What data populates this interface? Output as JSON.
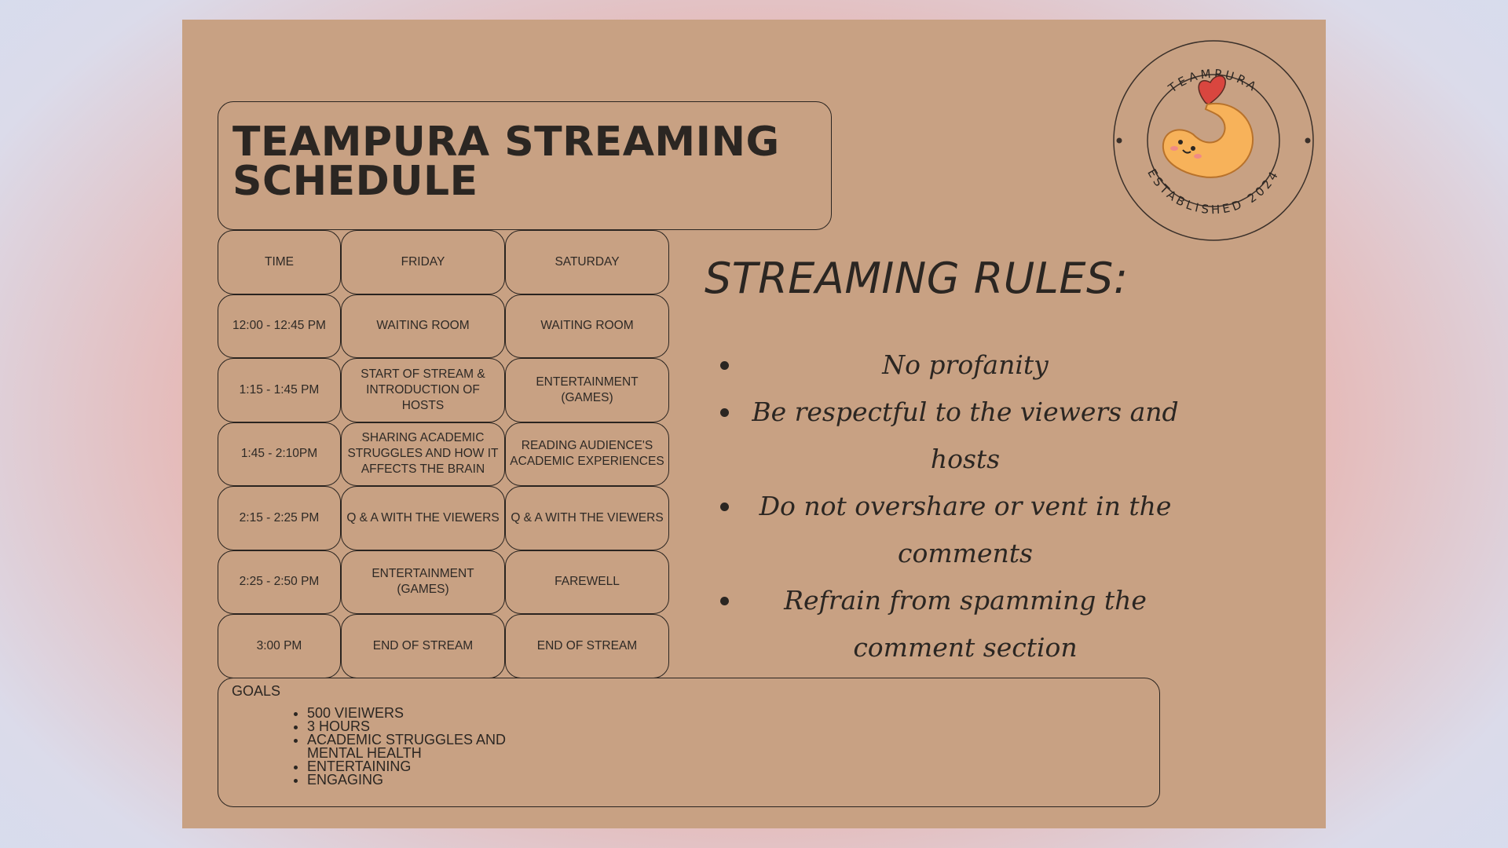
{
  "title": "TEAMPURA STREAMING\nSCHEDULE",
  "schedule": {
    "headers": [
      "TIME",
      "FRIDAY",
      "SATURDAY"
    ],
    "rows": [
      [
        "12:00 - 12:45 PM",
        "WAITING ROOM",
        "WAITING ROOM"
      ],
      [
        "1:15 - 1:45 PM",
        "START OF STREAM & INTRODUCTION OF HOSTS",
        "ENTERTAINMENT (GAMES)"
      ],
      [
        "1:45 - 2:10PM",
        "SHARING ACADEMIC STRUGGLES AND HOW IT AFFECTS THE BRAIN",
        "READING AUDIENCE'S ACADEMIC EXPERIENCES"
      ],
      [
        "2:15 - 2:25 PM",
        "Q & A WITH THE VIEWERS",
        "Q & A WITH THE VIEWERS"
      ],
      [
        "2:25 - 2:50 PM",
        "ENTERTAINMENT (GAMES)",
        "FAREWELL"
      ],
      [
        "3:00 PM",
        "END OF STREAM",
        "END OF STREAM"
      ]
    ]
  },
  "goals": {
    "label": "GOALS",
    "items": [
      "500 VIEIWERS",
      "3 HOURS",
      "ACADEMIC STRUGGLES AND MENTAL HEALTH",
      "ENTERTAINING",
      "ENGAGING"
    ]
  },
  "rules": {
    "title": "STREAMING RULES:",
    "items": [
      "No profanity",
      "Be respectful to the viewers and hosts",
      "Do not overshare or vent in the comments",
      "Refrain from spamming the comment section"
    ]
  },
  "logo": {
    "top_text": "TEAMPURA",
    "bottom_text": "ESTABLISHED 2024",
    "icon": "tempura-shrimp-icon"
  },
  "colors": {
    "poster_bg": "#c8a183",
    "ink": "#2b2622",
    "shrimp_body": "#f7b25a",
    "shrimp_tail": "#d9463f"
  }
}
